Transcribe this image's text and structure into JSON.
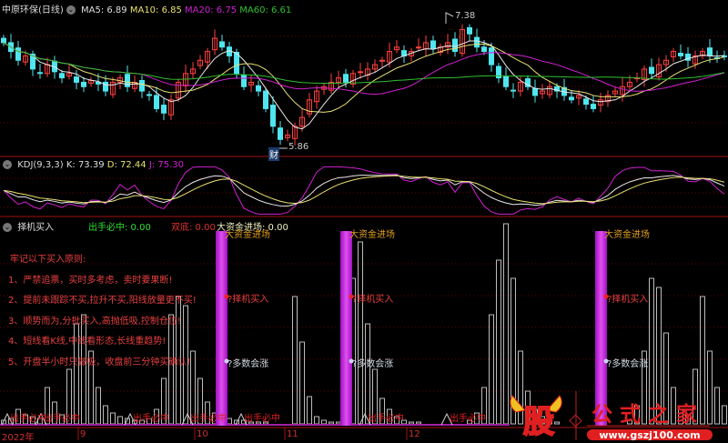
{
  "main": {
    "title": "中原环保(日线)",
    "ma5_label": "MA5: 6.89",
    "ma10_label": "MA10: 6.85",
    "ma20_label": "MA20: 6.75",
    "ma60_label": "MA60: 6.61",
    "high_marker": "7.38",
    "low_marker": "5.86",
    "badge": "财"
  },
  "kdj": {
    "title": "KDJ(9,3,3)",
    "k_label": "K: 73.39",
    "d_label": "D: 72.44",
    "j_label": "J: 75.30"
  },
  "ind": {
    "title": "择机买入",
    "chushou": "出手必中: 0.00",
    "shuangdi": "双底: 0.00",
    "dazijin": "大资金进场: 0.00",
    "notes": [
      "牢记以下买入原则:",
      "1、严禁追票，买时多考虑，卖时要果断!",
      "2、提前未跟踪不买,拉升不买,阳线放量更不买!",
      "3、顺势而为,分批买入,高抛低吸,控制仓位!",
      "4、短线看K线,中线看形态,长线重趋势!",
      "5、开盘半小时只做吸，收盘前三分钟买确认!"
    ],
    "signal_top": "大资金进场",
    "signal_mid": "?择机买入",
    "signal_low": "?多数会涨",
    "chushou_mark": "出手必中"
  },
  "axis": {
    "labels": [
      "2022年",
      "9",
      "10",
      "11",
      "12"
    ]
  },
  "logo": {
    "char": "股",
    "name": "公式之家",
    "url": "www.gszj100.com"
  },
  "colors": {
    "up": "#ff4040",
    "down": "#4fe6f0",
    "ma5": "#e8e8e8",
    "ma10": "#e8e070",
    "ma20": "#d020d0",
    "ma60": "#30c030"
  },
  "chart_data": {
    "type": "candlestick",
    "price_range": [
      5.86,
      7.38
    ],
    "closes": [
      7.05,
      6.95,
      6.85,
      6.9,
      6.75,
      6.7,
      6.8,
      6.72,
      6.65,
      6.7,
      6.6,
      6.55,
      6.62,
      6.58,
      6.5,
      6.6,
      6.65,
      6.55,
      6.6,
      6.5,
      6.45,
      6.3,
      6.25,
      6.4,
      6.6,
      6.7,
      6.75,
      6.85,
      6.95,
      7.1,
      7.0,
      6.9,
      6.7,
      6.55,
      6.6,
      6.5,
      6.3,
      6.1,
      5.95,
      6.0,
      6.1,
      6.2,
      6.4,
      6.5,
      6.55,
      6.6,
      6.65,
      6.6,
      6.7,
      6.72,
      6.75,
      6.8,
      6.85,
      6.95,
      7.0,
      6.9,
      6.95,
      7.0,
      7.05,
      6.98,
      7.0,
      7.05,
      6.95,
      7.2,
      7.15,
      7.0,
      6.95,
      6.8,
      6.65,
      6.55,
      6.5,
      6.6,
      6.55,
      6.45,
      6.5,
      6.55,
      6.5,
      6.45,
      6.4,
      6.45,
      6.35,
      6.3,
      6.4,
      6.45,
      6.5,
      6.55,
      6.6,
      6.65,
      6.75,
      6.7,
      6.8,
      6.85,
      6.95,
      6.9,
      6.85,
      6.9,
      6.95,
      6.9,
      6.88,
      6.89
    ],
    "signal_bars": [
      2,
      3,
      8,
      5,
      4,
      3,
      20,
      12,
      5,
      30,
      55,
      60,
      40,
      20,
      10,
      6,
      4,
      3,
      2,
      2,
      3,
      8,
      25,
      60,
      70,
      65,
      40,
      25,
      12,
      6,
      4,
      3,
      2,
      2,
      1,
      1,
      1,
      0,
      0,
      0,
      70,
      45,
      15,
      4,
      2,
      1,
      1,
      60,
      80,
      100,
      55,
      30,
      14,
      8,
      4,
      2,
      1,
      1,
      0,
      0,
      0,
      0,
      0,
      0,
      2,
      6,
      20,
      60,
      90,
      110,
      80,
      40,
      18,
      8,
      4,
      2,
      1,
      0,
      0,
      0,
      0,
      0,
      0,
      0,
      0,
      0,
      2,
      10,
      40,
      80,
      75,
      50,
      20,
      8,
      5,
      30,
      70,
      40,
      20,
      10
    ],
    "buy_signal_index": [
      30,
      47,
      82
    ]
  }
}
